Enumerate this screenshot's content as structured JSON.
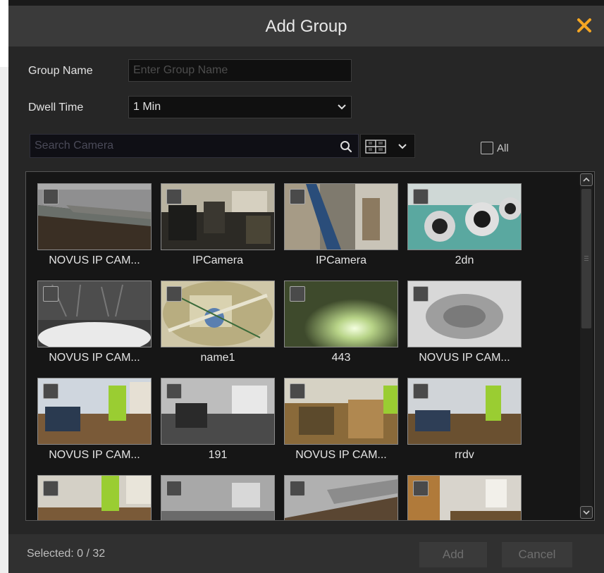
{
  "dialog": {
    "title": "Add Group"
  },
  "form": {
    "group_name_label": "Group Name",
    "group_name_placeholder": "Enter Group Name",
    "dwell_time_label": "Dwell Time",
    "dwell_time_value": "1 Min"
  },
  "search": {
    "placeholder": "Search Camera",
    "all_label": "All"
  },
  "cameras": [
    {
      "name": "NOVUS IP CAM..."
    },
    {
      "name": "IPCamera"
    },
    {
      "name": "IPCamera"
    },
    {
      "name": "2dn"
    },
    {
      "name": "NOVUS IP CAM..."
    },
    {
      "name": "name1"
    },
    {
      "name": "443"
    },
    {
      "name": "NOVUS IP CAM..."
    },
    {
      "name": "NOVUS IP CAM..."
    },
    {
      "name": "191"
    },
    {
      "name": "NOVUS IP CAM..."
    },
    {
      "name": "rrdv"
    }
  ],
  "footer": {
    "selected_text": "Selected: 0 / 32",
    "add_label": "Add",
    "cancel_label": "Cancel"
  },
  "colors": {
    "accent": "#f5a623",
    "background": "#262626",
    "titlebar": "#3a3a3a"
  }
}
